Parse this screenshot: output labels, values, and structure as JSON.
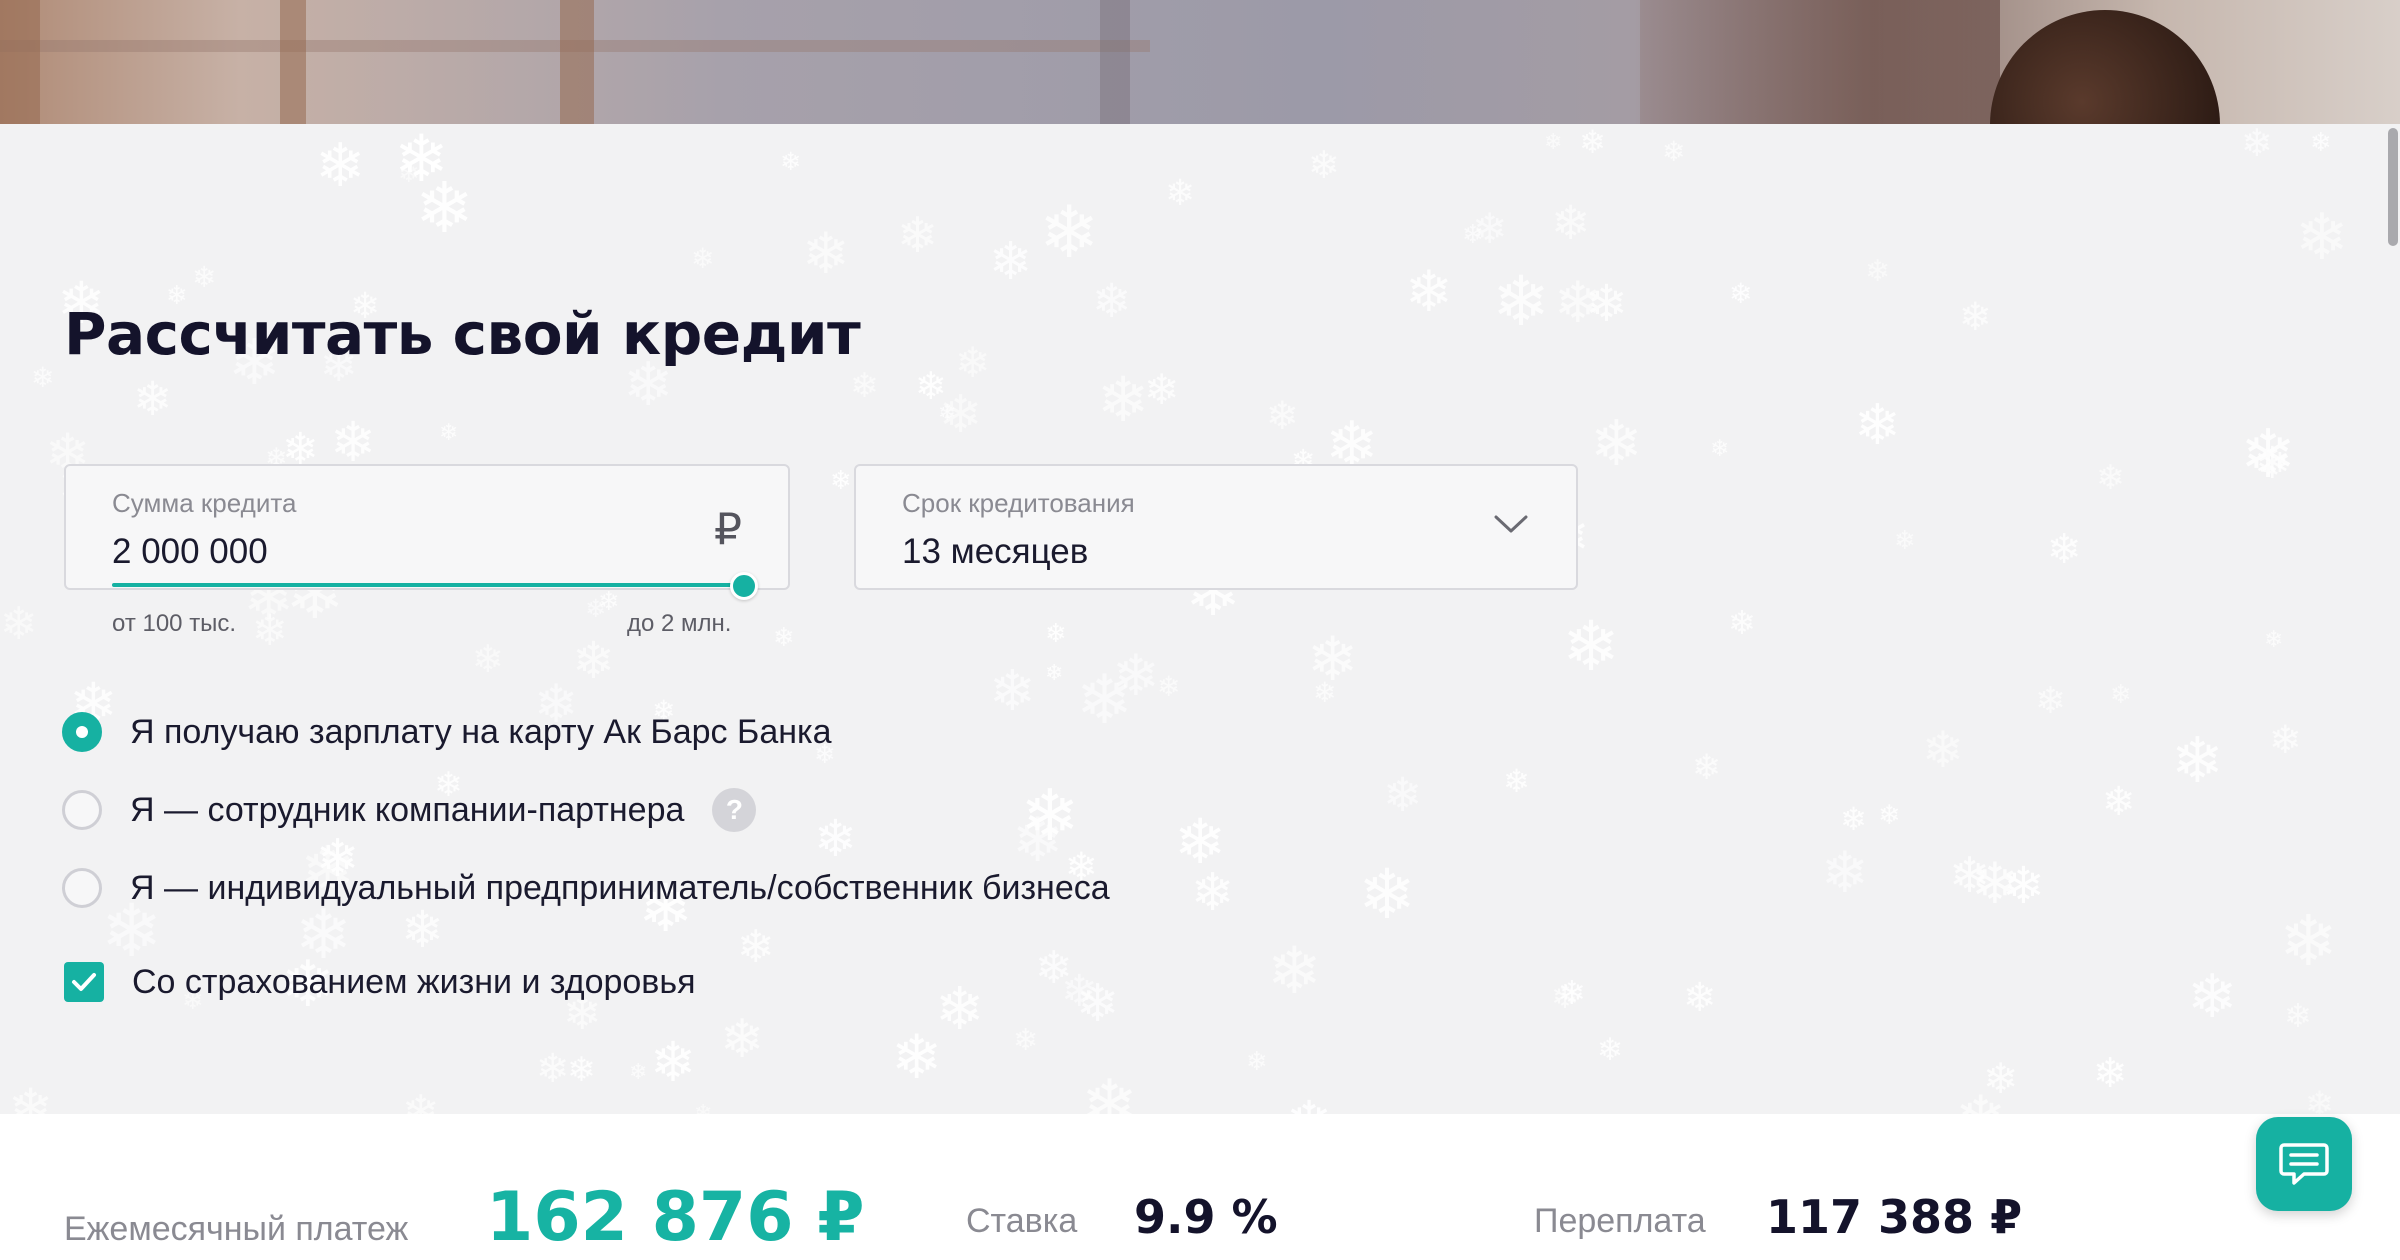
{
  "page": {
    "title": "Рассчитать свой кредит"
  },
  "amount_field": {
    "label": "Сумма кредита",
    "value": "2 000 000",
    "currency_symbol": "₽",
    "icon": "ruble-icon",
    "range_min_label": "от 100 тыс.",
    "range_max_label": "до 2 млн.",
    "slider_fraction": 1.0
  },
  "term_field": {
    "label": "Срок кредитования",
    "value": "13 месяцев",
    "icon": "chevron-down-icon"
  },
  "income_options": [
    {
      "label": "Я получаю зарплату на карту Ак Барс Банка",
      "checked": true
    },
    {
      "label": "Я — сотрудник компании-партнера",
      "checked": false,
      "help": "?"
    },
    {
      "label": "Я — индивидуальный предприниматель/собственник бизнеса",
      "checked": false
    }
  ],
  "insurance": {
    "label": "Со страхованием жизни и здоровья",
    "checked": true
  },
  "results": {
    "monthly_label": "Ежемесячный платеж",
    "monthly_value": "162 876 ₽",
    "rate_label": "Ставка",
    "rate_value": "9.9 %",
    "overpay_label": "Переплата",
    "overpay_value": "117 388 ₽"
  },
  "chat": {
    "icon": "chat-icon"
  },
  "colors": {
    "accent": "#16b1a2",
    "title": "#14132b",
    "background": "#f2f2f3",
    "muted": "#8a8a92"
  }
}
